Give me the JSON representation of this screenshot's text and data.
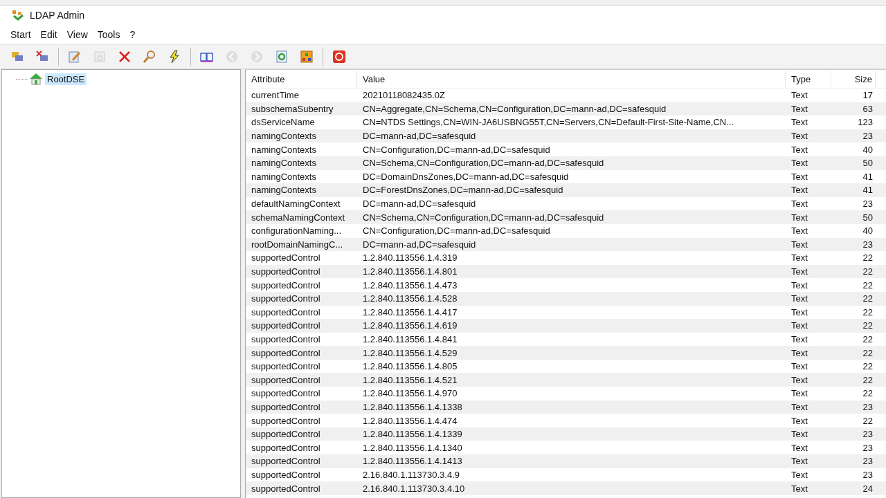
{
  "window": {
    "title": "LDAP Admin"
  },
  "menu": [
    "Start",
    "Edit",
    "View",
    "Tools",
    "?"
  ],
  "toolbar": [
    [
      {
        "kind": "connect",
        "disabled": false
      },
      {
        "kind": "disconnect",
        "disabled": false
      }
    ],
    [
      {
        "kind": "edit",
        "disabled": false
      },
      {
        "kind": "save",
        "disabled": true
      },
      {
        "kind": "delete",
        "disabled": false
      },
      {
        "kind": "search",
        "disabled": false
      },
      {
        "kind": "lightning",
        "disabled": false
      }
    ],
    [
      {
        "kind": "book",
        "disabled": false
      },
      {
        "kind": "back",
        "disabled": true
      },
      {
        "kind": "forward",
        "disabled": true
      },
      {
        "kind": "refresh",
        "disabled": false
      },
      {
        "kind": "tree",
        "disabled": false
      }
    ],
    [
      {
        "kind": "power",
        "disabled": false
      }
    ]
  ],
  "tree": [
    {
      "label": "RootDSE",
      "selected": true
    }
  ],
  "table": {
    "columns": [
      "Attribute",
      "Value",
      "Type",
      "Size"
    ],
    "rows": [
      [
        "currentTime",
        "20210118082435.0Z",
        "Text",
        "17"
      ],
      [
        "subschemaSubentry",
        "CN=Aggregate,CN=Schema,CN=Configuration,DC=mann-ad,DC=safesquid",
        "Text",
        "63"
      ],
      [
        "dsServiceName",
        "CN=NTDS Settings,CN=WIN-JA6USBNG55T,CN=Servers,CN=Default-First-Site-Name,CN...",
        "Text",
        "123"
      ],
      [
        "namingContexts",
        "DC=mann-ad,DC=safesquid",
        "Text",
        "23"
      ],
      [
        "namingContexts",
        "CN=Configuration,DC=mann-ad,DC=safesquid",
        "Text",
        "40"
      ],
      [
        "namingContexts",
        "CN=Schema,CN=Configuration,DC=mann-ad,DC=safesquid",
        "Text",
        "50"
      ],
      [
        "namingContexts",
        "DC=DomainDnsZones,DC=mann-ad,DC=safesquid",
        "Text",
        "41"
      ],
      [
        "namingContexts",
        "DC=ForestDnsZones,DC=mann-ad,DC=safesquid",
        "Text",
        "41"
      ],
      [
        "defaultNamingContext",
        "DC=mann-ad,DC=safesquid",
        "Text",
        "23"
      ],
      [
        "schemaNamingContext",
        "CN=Schema,CN=Configuration,DC=mann-ad,DC=safesquid",
        "Text",
        "50"
      ],
      [
        "configurationNaming...",
        "CN=Configuration,DC=mann-ad,DC=safesquid",
        "Text",
        "40"
      ],
      [
        "rootDomainNamingC...",
        "DC=mann-ad,DC=safesquid",
        "Text",
        "23"
      ],
      [
        "supportedControl",
        "1.2.840.113556.1.4.319",
        "Text",
        "22"
      ],
      [
        "supportedControl",
        "1.2.840.113556.1.4.801",
        "Text",
        "22"
      ],
      [
        "supportedControl",
        "1.2.840.113556.1.4.473",
        "Text",
        "22"
      ],
      [
        "supportedControl",
        "1.2.840.113556.1.4.528",
        "Text",
        "22"
      ],
      [
        "supportedControl",
        "1.2.840.113556.1.4.417",
        "Text",
        "22"
      ],
      [
        "supportedControl",
        "1.2.840.113556.1.4.619",
        "Text",
        "22"
      ],
      [
        "supportedControl",
        "1.2.840.113556.1.4.841",
        "Text",
        "22"
      ],
      [
        "supportedControl",
        "1.2.840.113556.1.4.529",
        "Text",
        "22"
      ],
      [
        "supportedControl",
        "1.2.840.113556.1.4.805",
        "Text",
        "22"
      ],
      [
        "supportedControl",
        "1.2.840.113556.1.4.521",
        "Text",
        "22"
      ],
      [
        "supportedControl",
        "1.2.840.113556.1.4.970",
        "Text",
        "22"
      ],
      [
        "supportedControl",
        "1.2.840.113556.1.4.1338",
        "Text",
        "23"
      ],
      [
        "supportedControl",
        "1.2.840.113556.1.4.474",
        "Text",
        "22"
      ],
      [
        "supportedControl",
        "1.2.840.113556.1.4.1339",
        "Text",
        "23"
      ],
      [
        "supportedControl",
        "1.2.840.113556.1.4.1340",
        "Text",
        "23"
      ],
      [
        "supportedControl",
        "1.2.840.113556.1.4.1413",
        "Text",
        "23"
      ],
      [
        "supportedControl",
        "2.16.840.1.113730.3.4.9",
        "Text",
        "23"
      ],
      [
        "supportedControl",
        "2.16.840.1.113730.3.4.10",
        "Text",
        "24"
      ]
    ]
  }
}
